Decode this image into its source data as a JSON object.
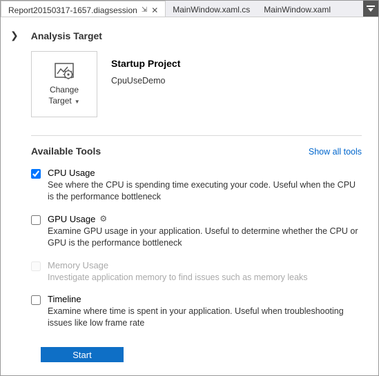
{
  "tabs": {
    "active": "Report20150317-1657.diagsession",
    "other1": "MainWindow.xaml.cs",
    "other2": "MainWindow.xaml"
  },
  "sections": {
    "analysis_target": "Analysis Target",
    "startup_project": "Startup Project",
    "project_name": "CpuUseDemo",
    "change_target_line1": "Change",
    "change_target_line2": "Target",
    "available_tools": "Available Tools",
    "show_all": "Show all tools"
  },
  "tools": [
    {
      "name": "CPU Usage",
      "desc": "See where the CPU is spending time executing your code. Useful when the CPU is the performance bottleneck",
      "checked": true,
      "enabled": true,
      "gear": false
    },
    {
      "name": "GPU Usage",
      "desc": "Examine GPU usage in your application. Useful to determine whether the CPU or GPU is the performance bottleneck",
      "checked": false,
      "enabled": true,
      "gear": true
    },
    {
      "name": "Memory Usage",
      "desc": "Investigate application memory to find issues such as memory leaks",
      "checked": false,
      "enabled": false,
      "gear": false
    },
    {
      "name": "Timeline",
      "desc": "Examine where time is spent in your application. Useful when troubleshooting issues like low frame rate",
      "checked": false,
      "enabled": true,
      "gear": false
    }
  ],
  "buttons": {
    "start": "Start"
  }
}
